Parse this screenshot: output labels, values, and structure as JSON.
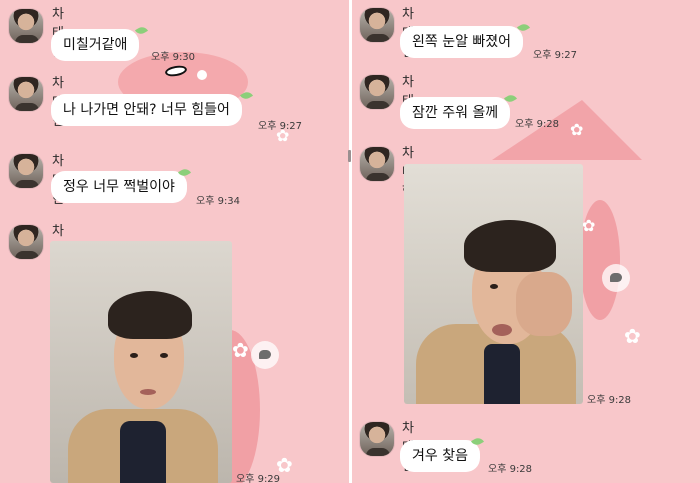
{
  "sender": "차태현",
  "left_pane": {
    "messages": [
      {
        "text": "미칠거같애",
        "time": "오후 9:30"
      },
      {
        "text": "나 나가면 안돼? 너무 힘들어",
        "time": "오후 9:27"
      },
      {
        "text": "정우 너무 쩍벌이야",
        "time": "오후 9:34"
      },
      {
        "photo": "selfie",
        "time": "오후 9:29"
      }
    ]
  },
  "right_pane": {
    "messages": [
      {
        "text": "왼쪽 눈알 빠졌어",
        "time": "오후 9:27"
      },
      {
        "text": "잠깐 주워 올께",
        "time": "오후 9:28"
      },
      {
        "photo": "holding-eye",
        "time": "오후 9:28"
      },
      {
        "text": "겨우 찾음",
        "time": "오후 9:28"
      }
    ]
  },
  "icons": {
    "share": "share-bubble-icon",
    "leaf": "leaf-icon",
    "flower": "flower-icon"
  },
  "colors": {
    "background": "#f8c7ca",
    "bubble": "#ffffff",
    "leaf": "#8ccf7a",
    "divider": "#ffffff"
  }
}
